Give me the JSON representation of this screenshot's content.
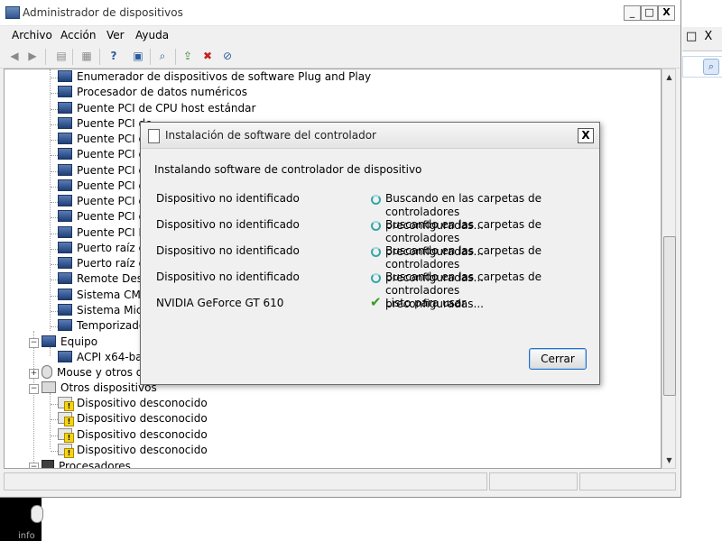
{
  "window": {
    "title": "Administrador de dispositivos",
    "controls": {
      "minimize": "_",
      "maximize": "□",
      "close": "X"
    }
  },
  "menu": {
    "items": [
      "Archivo",
      "Acción",
      "Ver",
      "Ayuda"
    ]
  },
  "toolbar": {
    "buttons": [
      "back-icon",
      "forward-icon",
      "show-hide-tree-icon",
      "properties-icon",
      "help-icon",
      "view-icon",
      "scan-changes-icon",
      "update-driver-icon",
      "uninstall-icon",
      "disable-icon"
    ]
  },
  "tree": {
    "items": [
      {
        "label": "Enumerador de dispositivos de software Plug and Play",
        "icon": "device-icon"
      },
      {
        "label": "Procesador de datos numéricos",
        "icon": "device-icon"
      },
      {
        "label": "Puente PCI de CPU host estándar",
        "icon": "device-icon"
      },
      {
        "label": "Puente PCI de",
        "icon": "device-icon"
      },
      {
        "label": "Puente PCI de",
        "icon": "device-icon"
      },
      {
        "label": "Puente PCI de",
        "icon": "device-icon"
      },
      {
        "label": "Puente PCI de",
        "icon": "device-icon"
      },
      {
        "label": "Puente PCI de",
        "icon": "device-icon"
      },
      {
        "label": "Puente PCI de",
        "icon": "device-icon"
      },
      {
        "label": "Puente PCI est",
        "icon": "device-icon"
      },
      {
        "label": "Puente PCI ISA",
        "icon": "device-icon"
      },
      {
        "label": "Puerto raíz est",
        "icon": "device-icon"
      },
      {
        "label": "Puerto raíz est",
        "icon": "device-icon"
      },
      {
        "label": "Remote Deskt",
        "icon": "device-icon"
      },
      {
        "label": "Sistema CMOS",
        "icon": "device-icon"
      },
      {
        "label": "Sistema Micro",
        "icon": "device-icon"
      },
      {
        "label": "Temporizador",
        "icon": "device-icon"
      }
    ],
    "categories": [
      {
        "label": "Equipo",
        "expanded": true,
        "icon": "computer-icon"
      },
      {
        "label": "ACPI x64-base",
        "icon": "computer-icon"
      },
      {
        "label": "Mouse y otros dis",
        "expanded": false,
        "icon": "mouse-icon"
      },
      {
        "label": "Otros dispositivos",
        "expanded": true,
        "icon": "other-devices-icon"
      }
    ],
    "unknown_devices": [
      "Dispositivo desconocido",
      "Dispositivo desconocido",
      "Dispositivo desconocido",
      "Dispositivo desconocido"
    ],
    "last_category": {
      "label": "Procesadores",
      "icon": "processor-icon"
    }
  },
  "dialog": {
    "title": "Instalación de software del controlador",
    "heading": "Instalando software de controlador de dispositivo",
    "rows": [
      {
        "device": "Dispositivo no identificado",
        "status_line1": "Buscando en las carpetas de controladores",
        "status_line2": "preconfiguradas...",
        "state": "searching"
      },
      {
        "device": "Dispositivo no identificado",
        "status_line1": "Buscando en las carpetas de controladores",
        "status_line2": "preconfiguradas...",
        "state": "searching"
      },
      {
        "device": "Dispositivo no identificado",
        "status_line1": "Buscando en las carpetas de controladores",
        "status_line2": "preconfiguradas...",
        "state": "searching"
      },
      {
        "device": "Dispositivo no identificado",
        "status_line1": "Buscando en las carpetas de controladores",
        "status_line2": "preconfiguradas...",
        "state": "searching"
      },
      {
        "device": "NVIDIA GeForce GT 610",
        "status_line1": "Listo para usar",
        "status_line2": "",
        "state": "ready"
      }
    ],
    "close_button": "Cerrar",
    "close_icon": "X"
  },
  "background_window": {
    "controls": "□ X",
    "bottom_text": "info"
  },
  "colors": {
    "spinner": "#33a6a8",
    "check": "#3a9a2a",
    "warning": "#f5d415",
    "button_focus": "#2b6fc0"
  }
}
